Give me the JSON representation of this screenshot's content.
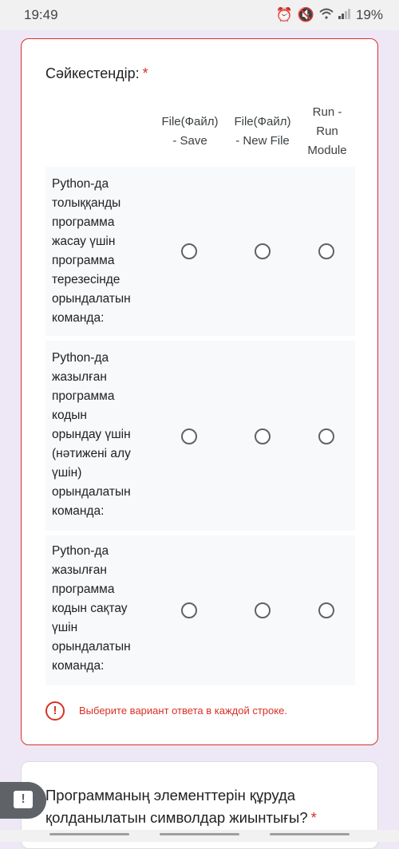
{
  "status_bar": {
    "time": "19:49",
    "battery": "19%",
    "icons": [
      "alarm-icon",
      "mute-icon",
      "wifi-icon",
      "signal-icon"
    ]
  },
  "question1": {
    "title": "Сәйкестендір:",
    "required_mark": "*",
    "columns": [
      {
        "line1": "File(Файл)",
        "line2": "- Save",
        "line3": ""
      },
      {
        "line1": "File(Файл)",
        "line2": "- New File",
        "line3": ""
      },
      {
        "line1": "Run -",
        "line2": "Run",
        "line3": "Module"
      }
    ],
    "rows": [
      {
        "lines": [
          "Python-да",
          "толыққанды",
          "программа",
          "жасау үшін",
          "программа",
          "терезесінде",
          "орындалатын",
          "команда:"
        ]
      },
      {
        "lines": [
          "Python-да",
          "жазылған",
          "программа",
          "кодын",
          "орындау үшін",
          "(нәтижені алу",
          "үшін)",
          "орындалатын",
          "команда:"
        ]
      },
      {
        "lines": [
          "Python-да",
          "жазылған",
          "программа",
          "кодын сақтау",
          "үшін",
          "орындалатын",
          "команда:"
        ]
      }
    ],
    "error_icon": "!",
    "error_text": "Выберите вариант ответа в каждой строке."
  },
  "question2": {
    "title": "Программаның элементтерін құруда қолданылатын символдар жиынтығы?",
    "required_mark": "*"
  },
  "colors": {
    "background": "#ede7f6",
    "error": "#d93025",
    "row_bg": "#f8f9fa"
  }
}
